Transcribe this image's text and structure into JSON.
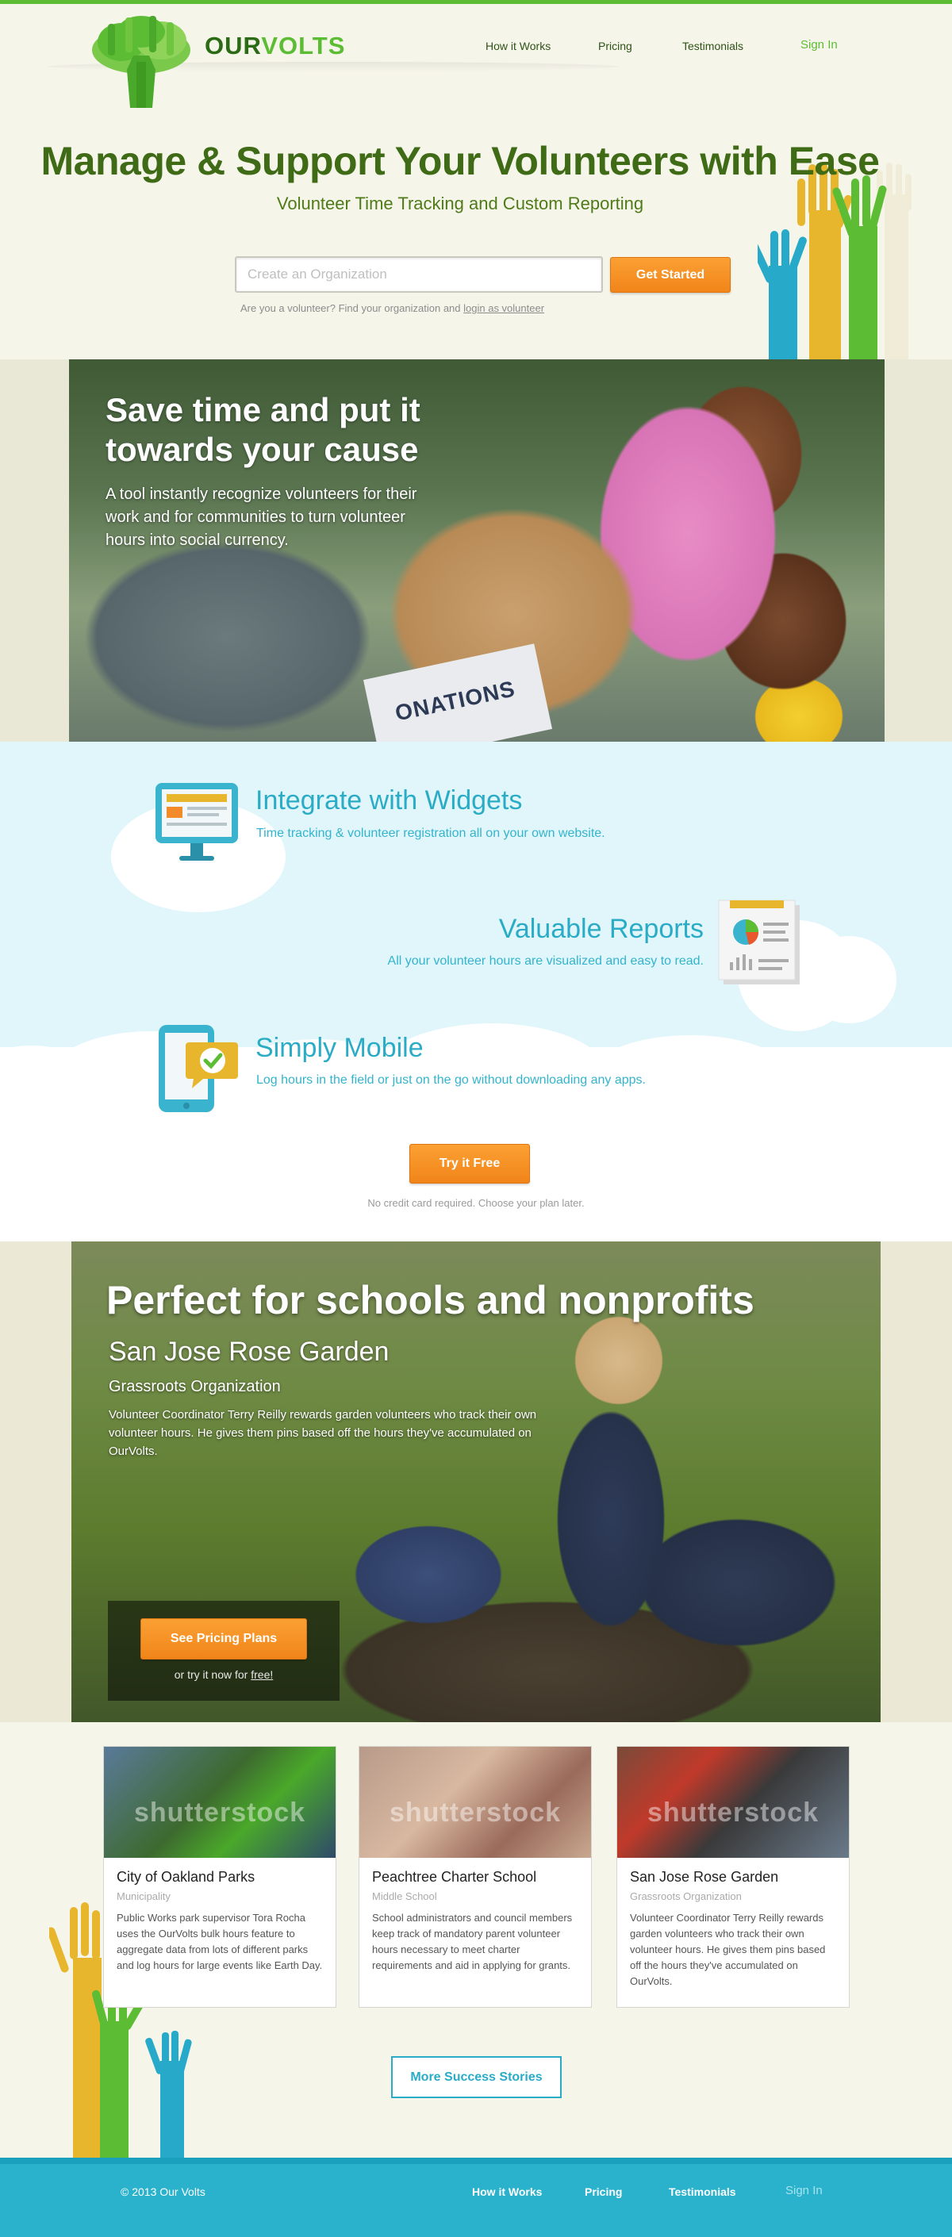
{
  "brand": {
    "name_part1": "OUR",
    "name_part2": "VOLTS",
    "accent_green": "#5cbd34",
    "accent_orange": "#f59323",
    "accent_blue": "#2aabc6"
  },
  "nav": {
    "items": [
      {
        "label": "How it Works"
      },
      {
        "label": "Pricing"
      },
      {
        "label": "Testimonials"
      }
    ],
    "signin": "Sign In"
  },
  "hero": {
    "title": "Manage & Support Your Volunteers with Ease",
    "subtitle": "Volunteer Time Tracking and Custom Reporting",
    "input_placeholder": "Create an Organization",
    "button": "Get Started",
    "volunteer_note": "Are you a volunteer? Find your organization and",
    "volunteer_link": "login as volunteer"
  },
  "photo_band": {
    "title": "Save time and put it towards your cause",
    "text": "A tool instantly recognize volunteers for their work and for communities to turn volunteer hours into social currency.",
    "box_text": "ONATIONS"
  },
  "features": [
    {
      "icon": "monitor-icon",
      "title": "Integrate with Widgets",
      "text": "Time tracking & volunteer registration all on your own website."
    },
    {
      "icon": "report-icon",
      "title": "Valuable Reports",
      "text": "All your volunteer hours are visualized and easy to read."
    },
    {
      "icon": "mobile-icon",
      "title": "Simply Mobile",
      "text": "Log hours in the field or just on the go without downloading any apps."
    }
  ],
  "try_free": {
    "button": "Try it Free",
    "note": "No credit card required. Choose your plan later."
  },
  "schools": {
    "title": "Perfect for schools and nonprofits",
    "org_name": "San Jose Rose Garden",
    "org_kind": "Grassroots Organization",
    "text": "Volunteer Coordinator Terry Reilly rewards garden volunteers who track their own volunteer hours.  He gives them pins based off the hours they've accumulated on OurVolts.",
    "cta_button": "See Pricing Plans",
    "cta_note": "or try it now for",
    "cta_link": "free!"
  },
  "stories": {
    "watermark": "shutterstock",
    "cards": [
      {
        "title": "City of Oakland Parks",
        "kind": "Municipality",
        "text": "Public Works park supervisor Tora Rocha uses the OurVolts bulk hours feature to aggregate data from lots of different parks and log hours for large events like Earth Day."
      },
      {
        "title": "Peachtree Charter School",
        "kind": "Middle School",
        "text": "School administrators and council members keep track of mandatory parent volunteer hours necessary to meet charter requirements and aid in applying for grants."
      },
      {
        "title": "San Jose Rose Garden",
        "kind": "Grassroots Organization",
        "text": "Volunteer Coordinator Terry Reilly rewards garden volunteers who track their own volunteer hours.  He gives them pins based off the hours they've accumulated on OurVolts."
      }
    ],
    "more_button": "More Success Stories"
  },
  "footer": {
    "copyright": "© 2013 Our Volts",
    "links": [
      {
        "label": "How it Works"
      },
      {
        "label": "Pricing"
      },
      {
        "label": "Testimonials"
      }
    ],
    "signin": "Sign In"
  }
}
